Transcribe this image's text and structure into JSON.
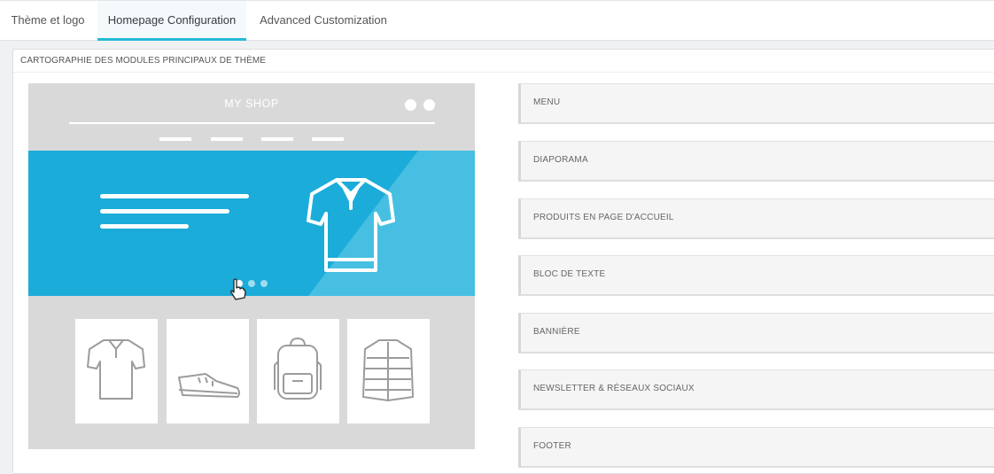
{
  "tabs": [
    {
      "label": "Thème et logo"
    },
    {
      "label": "Homepage Configuration",
      "active": true
    },
    {
      "label": "Advanced Customization"
    }
  ],
  "panel": {
    "title": "CARTOGRAPHIE DES MODULES PRINCIPAUX DE THÈME"
  },
  "preview": {
    "shop_name": "MY SHOP",
    "products": [
      "t-shirt",
      "sneaker",
      "backpack",
      "jacket"
    ]
  },
  "modules": [
    {
      "label": "MENU"
    },
    {
      "label": "DIAPORAMA"
    },
    {
      "label": "PRODUITS EN PAGE D'ACCUEIL"
    },
    {
      "label": "BLOC DE TEXTE"
    },
    {
      "label": "BANNIÈRE"
    },
    {
      "label": "NEWSLETTER & RÉSEAUX SOCIAUX"
    },
    {
      "label": "FOOTER"
    }
  ],
  "colors": {
    "accent": "#25b9d7",
    "hero": "#1bacd9",
    "preview_bg": "#d9d9d9"
  }
}
